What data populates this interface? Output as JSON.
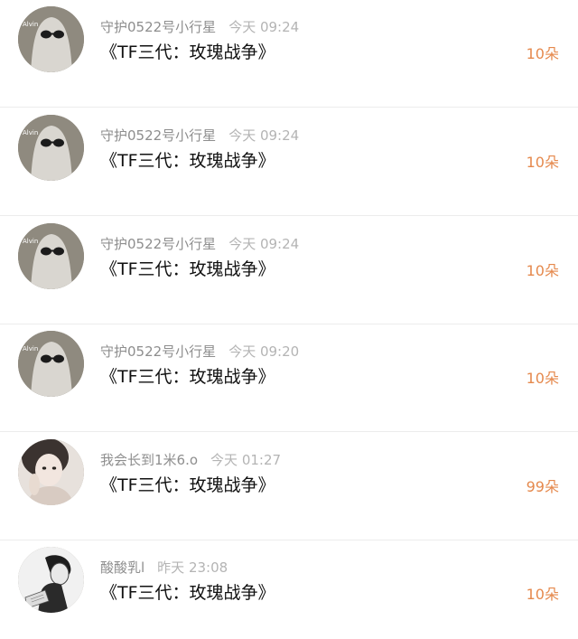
{
  "accent_color": "#e5894d",
  "items": [
    {
      "avatar_icon": "ghost-sunglasses-avatar",
      "avatar_text": "Alvin",
      "name": "守护0522号小行星",
      "time": "今天 09:24",
      "title": "《TF三代：玫瑰战争》",
      "count": "10朵"
    },
    {
      "avatar_icon": "ghost-sunglasses-avatar",
      "avatar_text": "Alvin",
      "name": "守护0522号小行星",
      "time": "今天 09:24",
      "title": "《TF三代：玫瑰战争》",
      "count": "10朵"
    },
    {
      "avatar_icon": "ghost-sunglasses-avatar",
      "avatar_text": "Alvin",
      "name": "守护0522号小行星",
      "time": "今天 09:24",
      "title": "《TF三代：玫瑰战争》",
      "count": "10朵"
    },
    {
      "avatar_icon": "ghost-sunglasses-avatar",
      "avatar_text": "Alvin",
      "name": "守护0522号小行星",
      "time": "今天 09:20",
      "title": "《TF三代：玫瑰战争》",
      "count": "10朵"
    },
    {
      "avatar_icon": "blurred-girl-photo-avatar",
      "avatar_text": "",
      "name": "我会长到1米6.o",
      "time": "今天 01:27",
      "title": "《TF三代：玫瑰战争》",
      "count": "99朵"
    },
    {
      "avatar_icon": "sketch-boy-avatar",
      "avatar_text": "",
      "name": "酸酸乳l",
      "time": "昨天 23:08",
      "title": "《TF三代：玫瑰战争》",
      "count": "10朵"
    }
  ]
}
